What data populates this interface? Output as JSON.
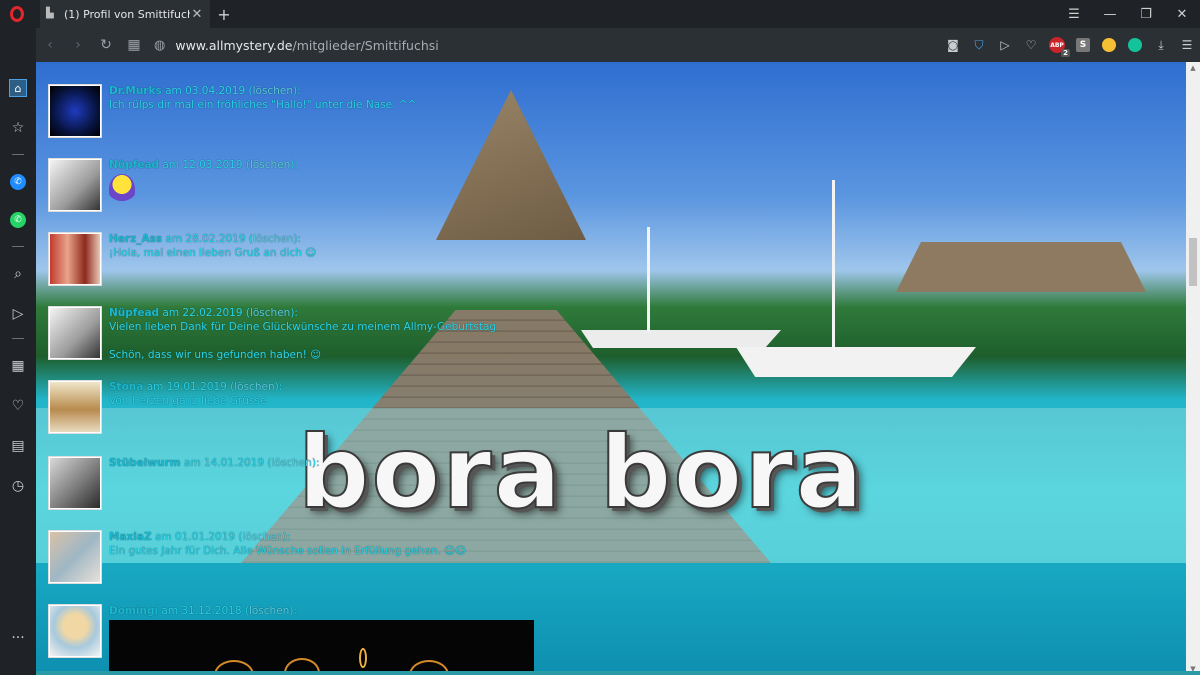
{
  "browser": {
    "tab_title": "(1) Profil von Smittifuchsi -",
    "tab_close": "✕",
    "new_tab": "+",
    "url_host": "www.allmystery.de",
    "url_path": "/mitglieder/Smittifuchsi",
    "adblock_count": "2",
    "adblock_label": "ABP"
  },
  "page": {
    "banner_text": "bora bora"
  },
  "guestbook": [
    {
      "name": "Dr.Murks",
      "date_prefix": " am 03.04.2019 (",
      "delete": "löschen",
      "date_suffix": "):",
      "message": "Ich rülps dir mal ein fröhliches \"Hallo!\" unter die Nase. ^^",
      "message2": ""
    },
    {
      "name": "Nüpfead",
      "date_prefix": " am 12.03.2019 (",
      "delete": "löschen",
      "date_suffix": "):",
      "message": "",
      "message2": ""
    },
    {
      "name": "Herz_Ass",
      "date_prefix": " am 28.02.2019 (",
      "delete": "löschen",
      "date_suffix": "):",
      "message": "¡Hola, mal einen lieben Gruß an dich ☺",
      "message2": ""
    },
    {
      "name": "Nüpfead",
      "date_prefix": " am 22.02.2019 (",
      "delete": "löschen",
      "date_suffix": "):",
      "message": "Vielen lieben Dank für Deine Glückwünsche zu meinem Allmy-Geburtstag.",
      "message2": "Schön, dass wir uns gefunden haben! ☺"
    },
    {
      "name": "Stona",
      "date_prefix": " am 19.01.2019 (",
      "delete": "löschen",
      "date_suffix": "):",
      "message": "Von Herzen ganz liebe Grüsse",
      "message2": ""
    },
    {
      "name": "Stübelwurm",
      "date_prefix": " am 14.01.2019 (",
      "delete": "löschen",
      "date_suffix": "):",
      "message": "",
      "message2": ""
    },
    {
      "name": "MaxiaZ",
      "date_prefix": " am 01.01.2019 (",
      "delete": "löschen",
      "date_suffix": "):",
      "message": "Ein gutes Jahr für Dich. Alle Wünsche sollen in Erfüllung gehen. ☺☺",
      "message2": ""
    },
    {
      "name": "Domingi",
      "date_prefix": " am 31.12.2018 (",
      "delete": "löschen",
      "date_suffix": "):",
      "message": "",
      "message2": ""
    }
  ],
  "colors": {
    "accent": "#2ad3e6",
    "opera_red": "#e3262a"
  }
}
